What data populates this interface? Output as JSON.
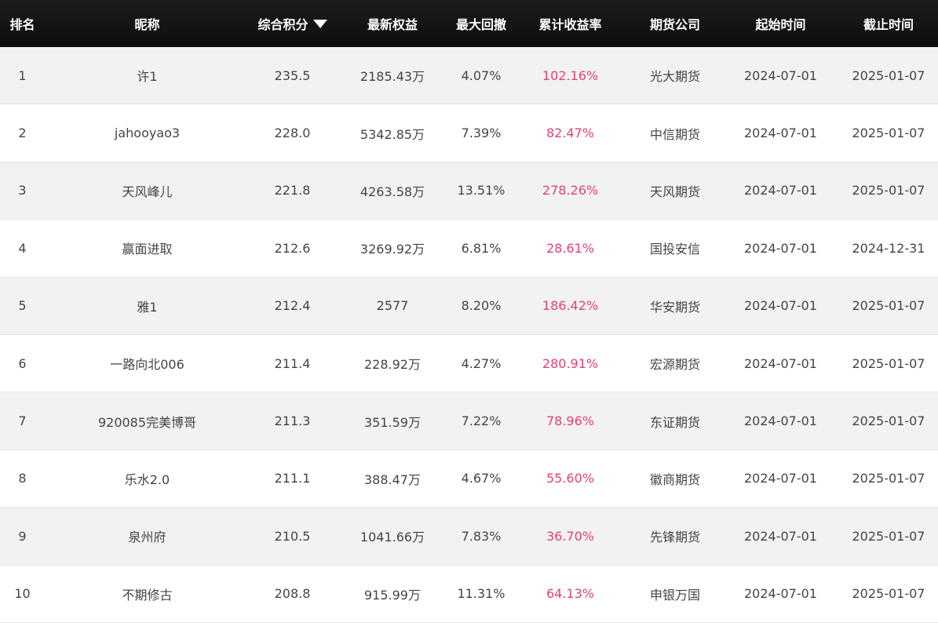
{
  "header": {
    "rank": "排名",
    "nickname": "昵称",
    "score": "综合积分",
    "equity": "最新权益",
    "drawdown": "最大回撤",
    "return": "累计收益率",
    "company": "期货公司",
    "start": "起始时间",
    "end": "截止时间"
  },
  "colors": {
    "header_bg": "#111111",
    "row_alt_bg": "#f2f2f2",
    "return_text": "#e5407a"
  },
  "rows": [
    {
      "rank": "1",
      "nickname": "许1",
      "score": "235.5",
      "equity": "2185.43万",
      "drawdown": "4.07%",
      "return": "102.16%",
      "company": "光大期货",
      "start": "2024-07-01",
      "end": "2025-01-07"
    },
    {
      "rank": "2",
      "nickname": "jahooyao3",
      "score": "228.0",
      "equity": "5342.85万",
      "drawdown": "7.39%",
      "return": "82.47%",
      "company": "中信期货",
      "start": "2024-07-01",
      "end": "2025-01-07"
    },
    {
      "rank": "3",
      "nickname": "天风峰儿",
      "score": "221.8",
      "equity": "4263.58万",
      "drawdown": "13.51%",
      "return": "278.26%",
      "company": "天风期货",
      "start": "2024-07-01",
      "end": "2025-01-07"
    },
    {
      "rank": "4",
      "nickname": "赢面进取",
      "score": "212.6",
      "equity": "3269.92万",
      "drawdown": "6.81%",
      "return": "28.61%",
      "company": "国投安信",
      "start": "2024-07-01",
      "end": "2024-12-31"
    },
    {
      "rank": "5",
      "nickname": "雅1",
      "score": "212.4",
      "equity": "2577",
      "drawdown": "8.20%",
      "return": "186.42%",
      "company": "华安期货",
      "start": "2024-07-01",
      "end": "2025-01-07"
    },
    {
      "rank": "6",
      "nickname": "一路向北006",
      "score": "211.4",
      "equity": "228.92万",
      "drawdown": "4.27%",
      "return": "280.91%",
      "company": "宏源期货",
      "start": "2024-07-01",
      "end": "2025-01-07"
    },
    {
      "rank": "7",
      "nickname": "920085完美博哥",
      "score": "211.3",
      "equity": "351.59万",
      "drawdown": "7.22%",
      "return": "78.96%",
      "company": "东证期货",
      "start": "2024-07-01",
      "end": "2025-01-07"
    },
    {
      "rank": "8",
      "nickname": "乐水2.0",
      "score": "211.1",
      "equity": "388.47万",
      "drawdown": "4.67%",
      "return": "55.60%",
      "company": "徽商期货",
      "start": "2024-07-01",
      "end": "2025-01-07"
    },
    {
      "rank": "9",
      "nickname": "泉州府",
      "score": "210.5",
      "equity": "1041.66万",
      "drawdown": "7.83%",
      "return": "36.70%",
      "company": "先锋期货",
      "start": "2024-07-01",
      "end": "2025-01-07"
    },
    {
      "rank": "10",
      "nickname": "不期修古",
      "score": "208.8",
      "equity": "915.99万",
      "drawdown": "11.31%",
      "return": "64.13%",
      "company": "申银万国",
      "start": "2024-07-01",
      "end": "2025-01-07"
    }
  ]
}
